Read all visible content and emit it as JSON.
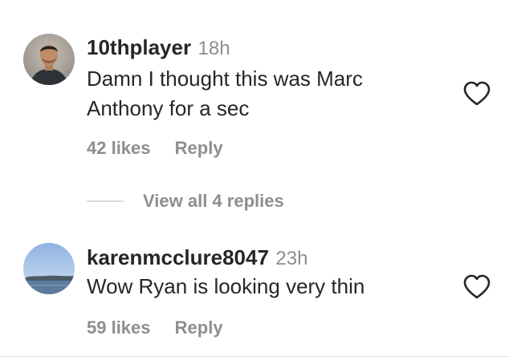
{
  "comments": [
    {
      "username": "10thplayer",
      "time": "18h",
      "text_line1": "Damn I thought this was Marc",
      "text_line2": "Anthony for a sec",
      "likes": "42 likes",
      "reply": "Reply",
      "avatar": "profile-photo-man"
    },
    {
      "username": "karenmcclure8047",
      "time": "23h",
      "text_line1": "Wow Ryan is looking very thin",
      "likes": "59 likes",
      "reply": "Reply",
      "avatar": "profile-photo-landscape"
    }
  ],
  "view_replies": "View all 4 replies",
  "icons": {
    "like": "heart-outline-icon"
  },
  "colors": {
    "primary_text": "#262626",
    "secondary_text": "#8e8e8e",
    "divider": "#dbdbdb"
  }
}
